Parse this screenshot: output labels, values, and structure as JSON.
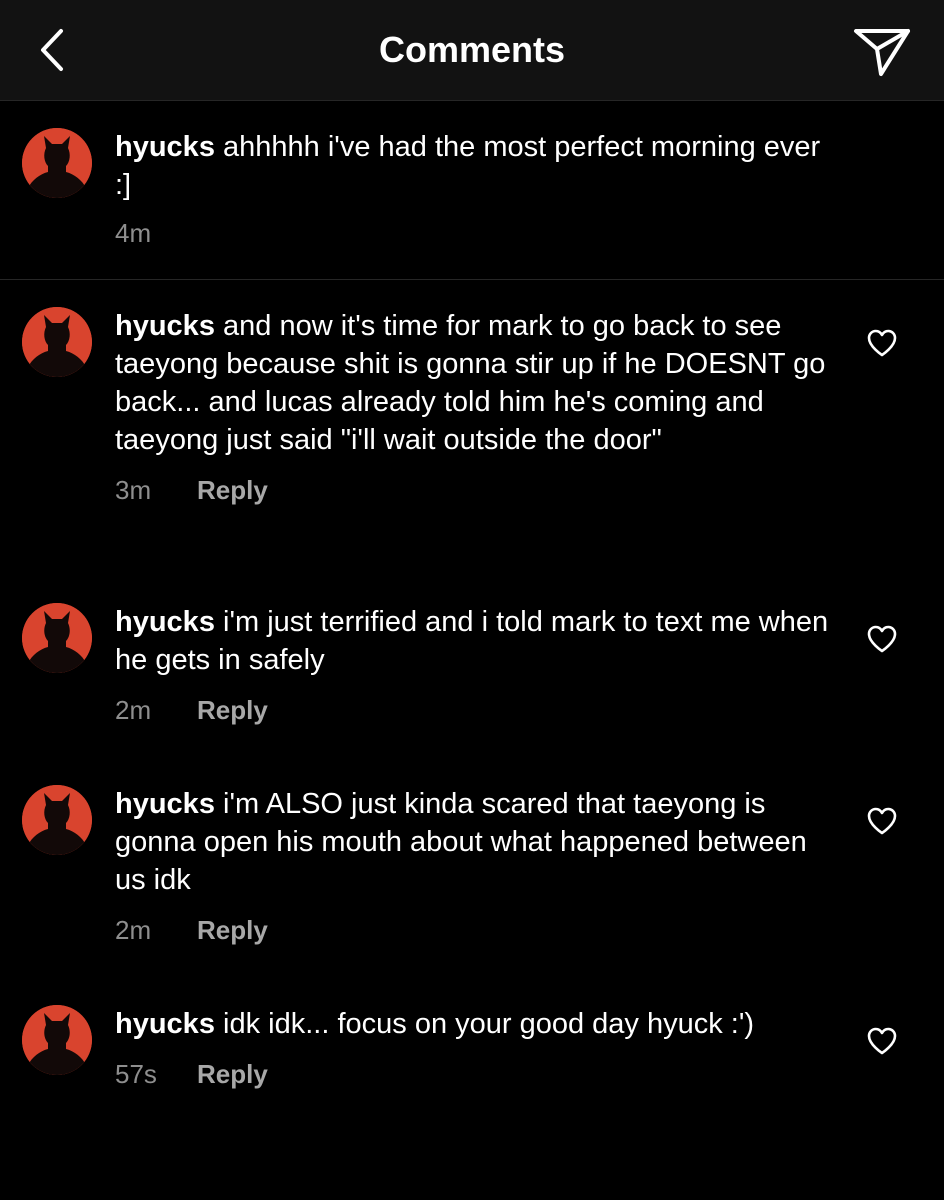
{
  "header": {
    "title": "Comments",
    "back_icon": "chevron-left-icon",
    "share_icon": "paper-plane-icon"
  },
  "caption": {
    "username": "hyucks",
    "text": "ahhhhh i've had the most perfect morning ever :]",
    "time": "4m"
  },
  "comments": [
    {
      "username": "hyucks",
      "text": "and now it's time for mark to go back to see taeyong because shit is gonna stir up if he DOESNT go back... and lucas already told him he's coming and taeyong just said \"i'll wait outside the door\"",
      "time": "3m",
      "reply_label": "Reply"
    },
    {
      "username": "hyucks",
      "text": "i'm just terrified and i told mark to text me when he gets in safely",
      "time": "2m",
      "reply_label": "Reply"
    },
    {
      "username": "hyucks",
      "text": "i'm ALSO just kinda scared that taeyong is gonna open his mouth about what happened between us idk",
      "time": "2m",
      "reply_label": "Reply"
    },
    {
      "username": "hyucks",
      "text": "idk idk... focus on your good day hyuck :')",
      "time": "57s",
      "reply_label": "Reply"
    }
  ],
  "colors": {
    "background": "#000000",
    "header_background": "#121212",
    "divider": "#262626",
    "text": "#ffffff",
    "secondary_text": "#8e8e8e",
    "avatar_background": "#d9442e"
  }
}
